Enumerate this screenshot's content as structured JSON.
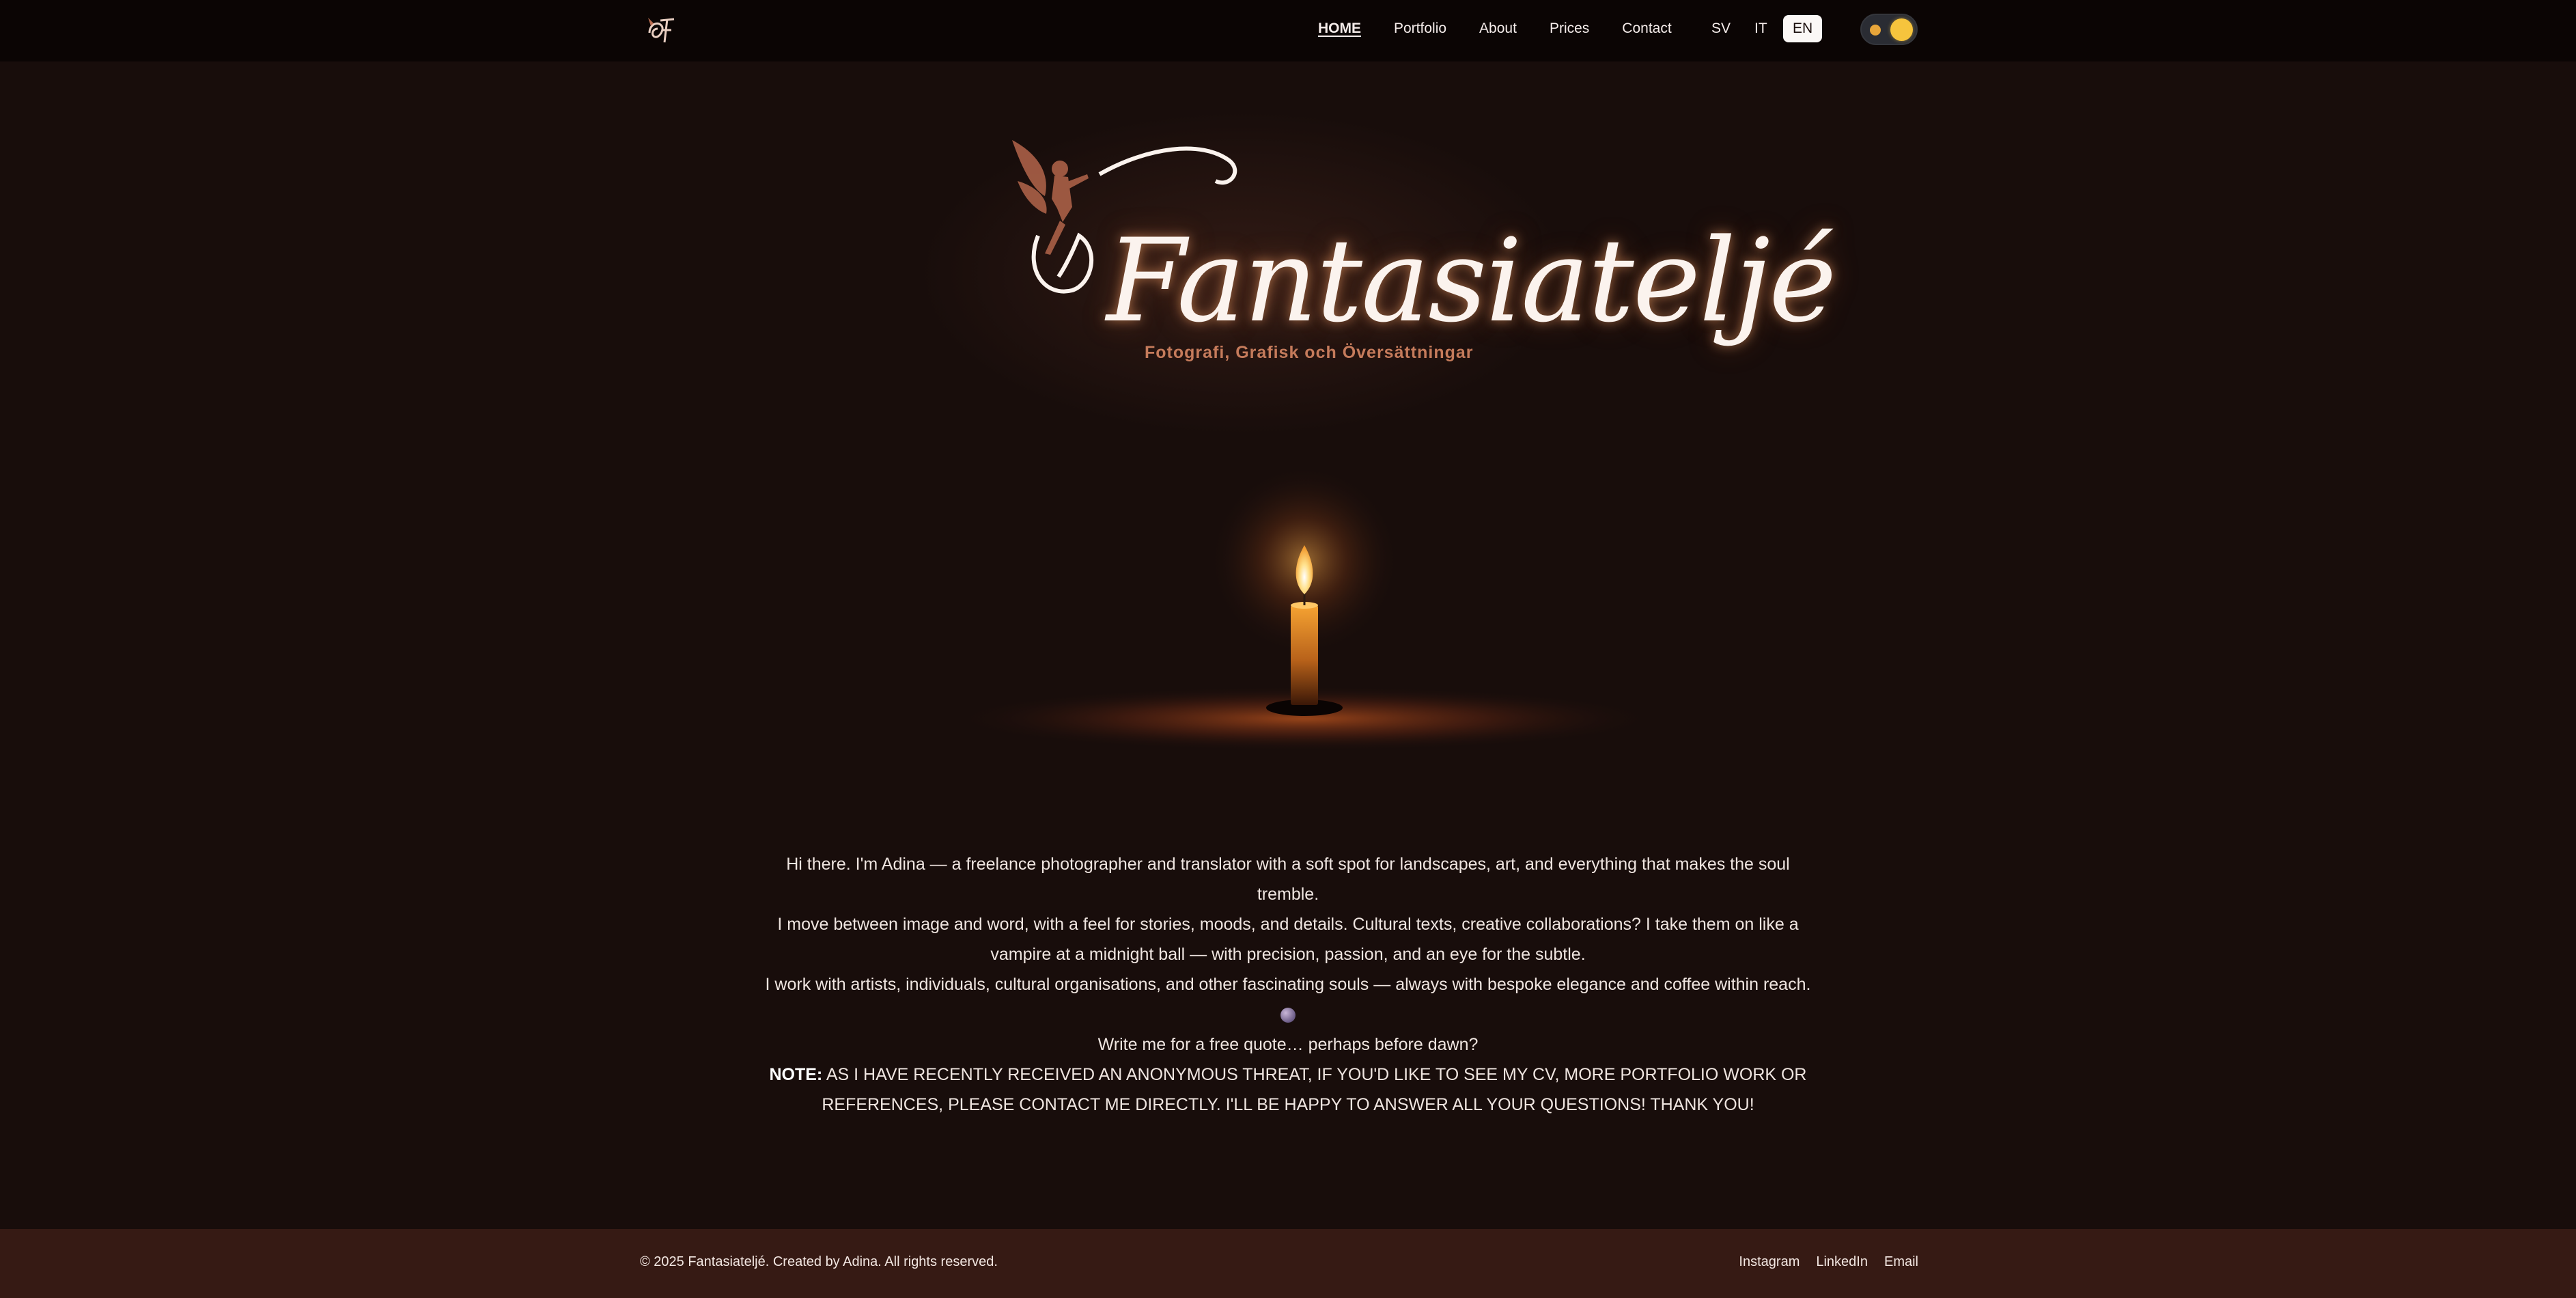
{
  "header": {
    "logo_alt": "Fantasiatelje logo",
    "nav": [
      {
        "label": "HOME",
        "active": true
      },
      {
        "label": "Portfolio",
        "active": false
      },
      {
        "label": "About",
        "active": false
      },
      {
        "label": "Prices",
        "active": false
      },
      {
        "label": "Contact",
        "active": false
      }
    ],
    "languages": [
      {
        "label": "SV",
        "active": false
      },
      {
        "label": "IT",
        "active": false
      },
      {
        "label": "EN",
        "active": true
      }
    ],
    "theme_toggle": {
      "state": "dark",
      "icon": "sun-icon"
    }
  },
  "hero": {
    "title": "Fantasiateljé",
    "subtitle": "Fotografi, Grafisk och Översättningar",
    "illustration": "fairy-icon",
    "image": "candle-icon"
  },
  "intro": {
    "line1": "Hi there. I'm Adina — a freelance photographer and translator with a soft spot for landscapes, art, and everything that makes the soul tremble.",
    "line2": "I move between image and word, with a feel for stories, moods, and details. Cultural texts, creative collaborations? I take them on like a vampire at a midnight ball — with precision, passion, and an eye for the subtle.",
    "line3": "I work with artists, individuals, cultural organisations, and other fascinating souls — always with bespoke elegance and coffee within reach.",
    "emoji": "crystal-ball-icon",
    "line4": "Write me for a free quote… perhaps before dawn?",
    "note_label": "NOTE:",
    "note_text": " AS I HAVE RECENTLY RECEIVED AN ANONYMOUS THREAT, IF YOU'D LIKE TO SEE MY CV, MORE PORTFOLIO WORK OR REFERENCES, PLEASE CONTACT ME DIRECTLY. I'LL BE HAPPY TO ANSWER ALL YOUR QUESTIONS! THANK YOU!"
  },
  "footer": {
    "copyright": "© 2025 Fantasiateljé. Created by Adina. All rights reserved.",
    "links": [
      "Instagram",
      "LinkedIn",
      "Email"
    ]
  },
  "colors": {
    "background": "#180d0b",
    "header": "#0b0504",
    "footer": "#361a14",
    "accent": "#c57b5b",
    "flame": "#f6c43d"
  }
}
